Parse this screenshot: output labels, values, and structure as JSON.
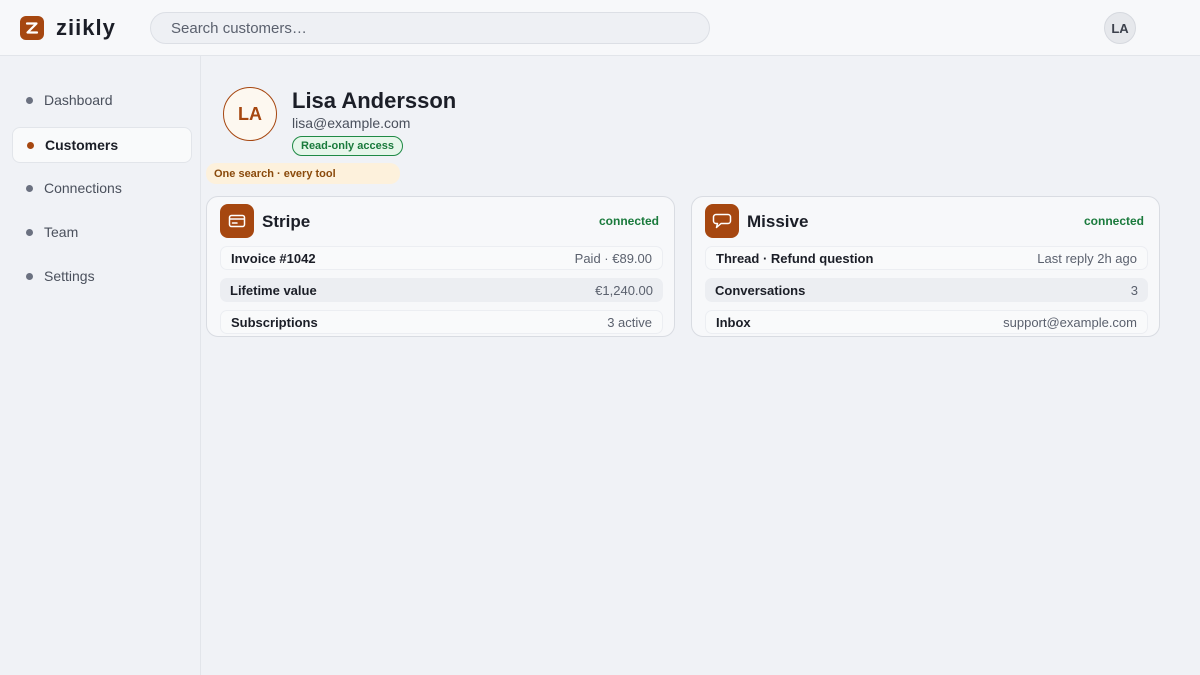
{
  "app": {
    "name": "ziikly",
    "search_placeholder": "Search customers…",
    "user_initials": "LA",
    "accent": "#a64710"
  },
  "sidebar": {
    "items": [
      {
        "label": "Dashboard",
        "active": false
      },
      {
        "label": "Customers",
        "active": true
      },
      {
        "label": "Connections",
        "active": false
      },
      {
        "label": "Team",
        "active": false
      },
      {
        "label": "Settings",
        "active": false
      }
    ]
  },
  "profile": {
    "initials": "LA",
    "name": "Lisa Andersson",
    "email": "lisa@example.com",
    "access_badge": "Read-only access",
    "hint": "One search · every tool"
  },
  "cards": [
    {
      "icon": "card-icon",
      "title": "Stripe",
      "status": "connected",
      "status_color": "#1a7a3c",
      "rows": [
        {
          "key": "Invoice #1042",
          "value": "Paid · €89.00"
        },
        {
          "key": "Lifetime value",
          "value": "€1,240.00"
        },
        {
          "key": "Subscriptions",
          "value": "3 active"
        }
      ]
    },
    {
      "icon": "chat-bubble-icon",
      "title": "Missive",
      "status": "connected",
      "status_color": "#1a7a3c",
      "rows": [
        {
          "key": "Thread · Refund question",
          "value": "Last reply 2h ago"
        },
        {
          "key": "Conversations",
          "value": "3"
        },
        {
          "key": "Inbox",
          "value": "support@example.com"
        }
      ]
    }
  ]
}
